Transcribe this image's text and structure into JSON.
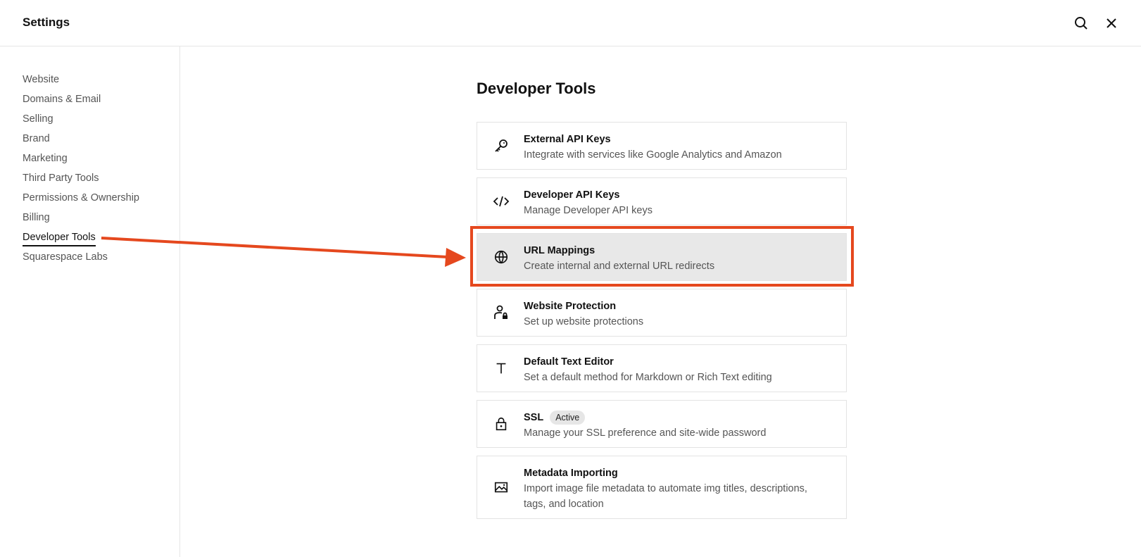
{
  "header": {
    "title": "Settings",
    "icons": {
      "search": "search-icon",
      "close": "close-icon"
    }
  },
  "sidebar": {
    "items": [
      {
        "label": "Website"
      },
      {
        "label": "Domains & Email"
      },
      {
        "label": "Selling"
      },
      {
        "label": "Brand"
      },
      {
        "label": "Marketing"
      },
      {
        "label": "Third Party Tools"
      },
      {
        "label": "Permissions & Ownership"
      },
      {
        "label": "Billing"
      },
      {
        "label": "Developer Tools",
        "active": true
      },
      {
        "label": "Squarespace Labs"
      }
    ]
  },
  "main": {
    "title": "Developer Tools",
    "cards": [
      {
        "name": "External API Keys",
        "desc": "Integrate with services like Google Analytics and Amazon",
        "icon": "key-icon"
      },
      {
        "name": "Developer API Keys",
        "desc": "Manage Developer API keys",
        "icon": "code-icon"
      },
      {
        "name": "URL Mappings",
        "desc": "Create internal and external URL redirects",
        "icon": "globe-icon",
        "highlighted": true
      },
      {
        "name": "Website Protection",
        "desc": "Set up website protections",
        "icon": "user-lock-icon"
      },
      {
        "name": "Default Text Editor",
        "desc": "Set a default method for Markdown or Rich Text editing",
        "icon": "text-icon"
      },
      {
        "name": "SSL",
        "badge": "Active",
        "desc": "Manage your SSL preference and site-wide password",
        "icon": "lock-icon"
      },
      {
        "name": "Metadata Importing",
        "desc": "Import image file metadata to automate img titles, descriptions, tags, and location",
        "icon": "image-icon"
      }
    ]
  },
  "annotation": {
    "color": "#e5481e"
  }
}
